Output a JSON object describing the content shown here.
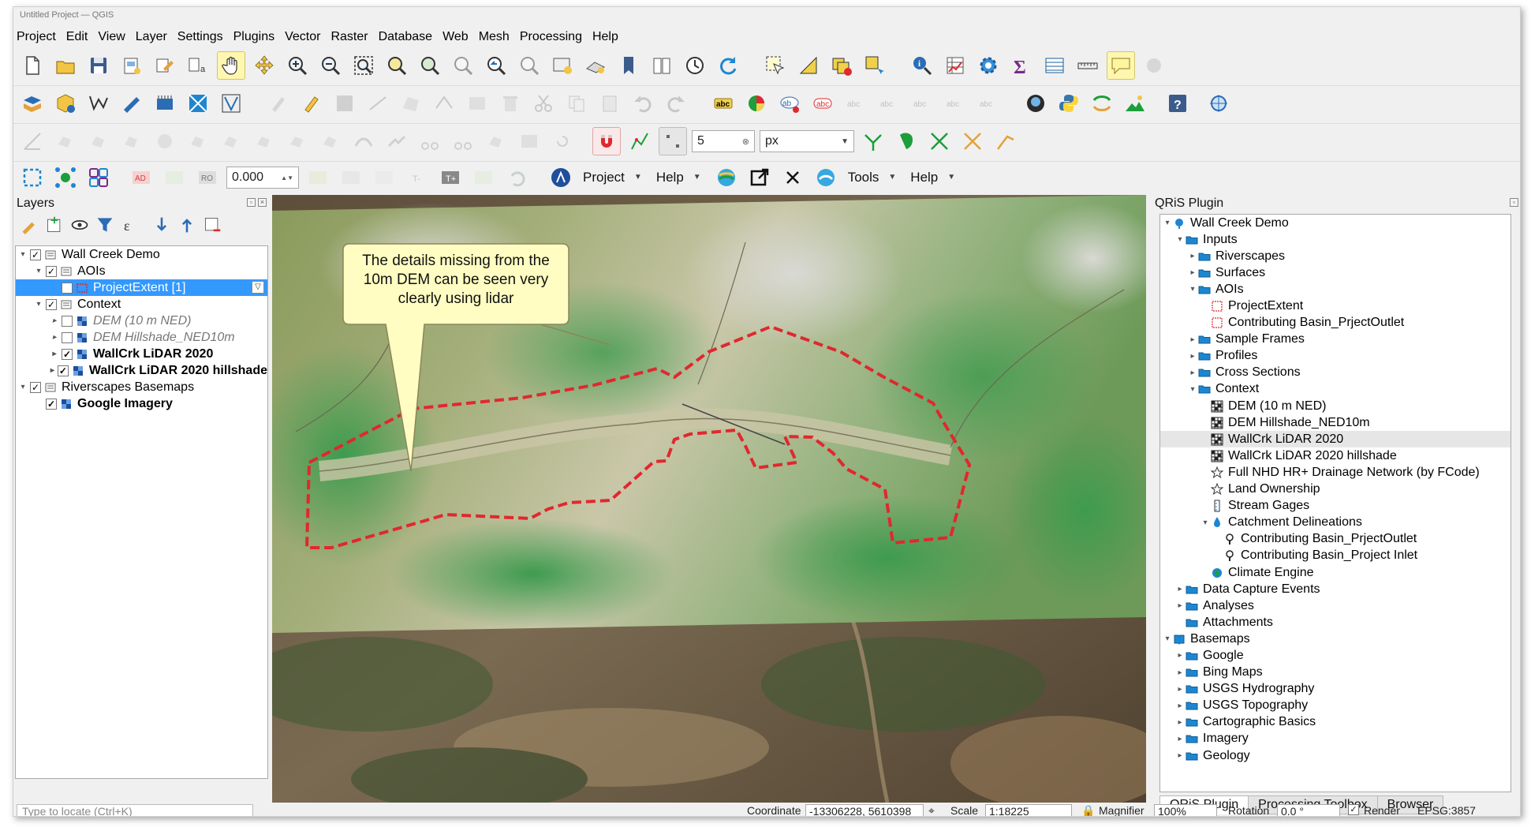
{
  "window": {
    "title": "Untitled Project — QGIS"
  },
  "menu": [
    "Project",
    "Edit",
    "View",
    "Layer",
    "Settings",
    "Plugins",
    "Vector",
    "Raster",
    "Database",
    "Web",
    "Mesh",
    "Processing",
    "Help"
  ],
  "snapping": {
    "tolerance": "5",
    "unit": "px"
  },
  "digitize": {
    "value": "0.000"
  },
  "plugin_toolbar": {
    "project": "Project",
    "help": "Help",
    "tools": "Tools",
    "help2": "Help"
  },
  "label_badges": {
    "abc": "abc",
    "ad": "AD",
    "ro": "RO",
    "t": "T+"
  },
  "layers": {
    "title": "Layers",
    "items": [
      {
        "label": "Wall Creek Demo",
        "indent": 0,
        "checked": true,
        "arrow": "▾",
        "style": "",
        "icon": "group"
      },
      {
        "label": "AOIs",
        "indent": 1,
        "checked": true,
        "arrow": "▾",
        "style": "",
        "icon": "group"
      },
      {
        "label": "ProjectExtent [1]",
        "indent": 2,
        "checked": true,
        "arrow": "",
        "style": "sel",
        "icon": "poly"
      },
      {
        "label": "Context",
        "indent": 1,
        "checked": true,
        "arrow": "▾",
        "style": "",
        "icon": "group"
      },
      {
        "label": "DEM (10 m NED)",
        "indent": 2,
        "checked": false,
        "arrow": "▸",
        "style": "ital",
        "icon": "raster"
      },
      {
        "label": "DEM Hillshade_NED10m",
        "indent": 2,
        "checked": false,
        "arrow": "▸",
        "style": "ital",
        "icon": "raster"
      },
      {
        "label": "WallCrk LiDAR 2020",
        "indent": 2,
        "checked": true,
        "arrow": "▸",
        "style": "bold",
        "icon": "raster"
      },
      {
        "label": "WallCrk LiDAR 2020 hillshade",
        "indent": 2,
        "checked": true,
        "arrow": "▸",
        "style": "bold",
        "icon": "raster"
      },
      {
        "label": "Riverscapes Basemaps",
        "indent": 0,
        "checked": true,
        "arrow": "▾",
        "style": "",
        "icon": "group"
      },
      {
        "label": "Google Imagery",
        "indent": 1,
        "checked": true,
        "arrow": "",
        "style": "bold",
        "icon": "raster"
      }
    ]
  },
  "locator": {
    "placeholder": "Type to locate (Ctrl+K)"
  },
  "callout": {
    "text": "The details missing from the 10m DEM can be seen very clearly using lidar"
  },
  "qris": {
    "title": "QRiS Plugin",
    "tree": [
      {
        "label": "Wall Creek Demo",
        "indent": 0,
        "arrow": "▾",
        "icon": "project"
      },
      {
        "label": "Inputs",
        "indent": 1,
        "arrow": "▾",
        "icon": "folder"
      },
      {
        "label": "Riverscapes",
        "indent": 2,
        "arrow": "▸",
        "icon": "folder"
      },
      {
        "label": "Surfaces",
        "indent": 2,
        "arrow": "▸",
        "icon": "folder"
      },
      {
        "label": "AOIs",
        "indent": 2,
        "arrow": "▾",
        "icon": "folder"
      },
      {
        "label": "ProjectExtent",
        "indent": 3,
        "arrow": "",
        "icon": "aoi"
      },
      {
        "label": "Contributing Basin_PrjectOutlet",
        "indent": 3,
        "arrow": "",
        "icon": "aoi"
      },
      {
        "label": "Sample Frames",
        "indent": 2,
        "arrow": "▸",
        "icon": "folder"
      },
      {
        "label": "Profiles",
        "indent": 2,
        "arrow": "▸",
        "icon": "folder"
      },
      {
        "label": "Cross Sections",
        "indent": 2,
        "arrow": "▸",
        "icon": "folder"
      },
      {
        "label": "Context",
        "indent": 2,
        "arrow": "▾",
        "icon": "folder"
      },
      {
        "label": "DEM (10 m NED)",
        "indent": 3,
        "arrow": "",
        "icon": "raster"
      },
      {
        "label": "DEM Hillshade_NED10m",
        "indent": 3,
        "arrow": "",
        "icon": "raster"
      },
      {
        "label": "WallCrk LiDAR 2020",
        "indent": 3,
        "arrow": "",
        "icon": "raster",
        "hl": true
      },
      {
        "label": "WallCrk LiDAR 2020 hillshade",
        "indent": 3,
        "arrow": "",
        "icon": "raster"
      },
      {
        "label": "Full NHD HR+ Drainage Network (by FCode)",
        "indent": 3,
        "arrow": "",
        "icon": "star"
      },
      {
        "label": "Land Ownership",
        "indent": 3,
        "arrow": "",
        "icon": "star"
      },
      {
        "label": "Stream Gages",
        "indent": 3,
        "arrow": "",
        "icon": "gage"
      },
      {
        "label": "Catchment Delineations",
        "indent": 3,
        "arrow": "▾",
        "icon": "drop"
      },
      {
        "label": "Contributing Basin_PrjectOutlet",
        "indent": 4,
        "arrow": "",
        "icon": "pin"
      },
      {
        "label": "Contributing Basin_Project Inlet",
        "indent": 4,
        "arrow": "",
        "icon": "pin"
      },
      {
        "label": "Climate Engine",
        "indent": 3,
        "arrow": "",
        "icon": "climate"
      },
      {
        "label": "Data Capture Events",
        "indent": 1,
        "arrow": "▸",
        "icon": "folder"
      },
      {
        "label": "Analyses",
        "indent": 1,
        "arrow": "▸",
        "icon": "folder"
      },
      {
        "label": "Attachments",
        "indent": 1,
        "arrow": "",
        "icon": "folder"
      },
      {
        "label": "Basemaps",
        "indent": 0,
        "arrow": "▾",
        "icon": "book"
      },
      {
        "label": "Google",
        "indent": 1,
        "arrow": "▸",
        "icon": "folder"
      },
      {
        "label": "Bing Maps",
        "indent": 1,
        "arrow": "▸",
        "icon": "folder"
      },
      {
        "label": "USGS Hydrography",
        "indent": 1,
        "arrow": "▸",
        "icon": "folder"
      },
      {
        "label": "USGS Topography",
        "indent": 1,
        "arrow": "▸",
        "icon": "folder"
      },
      {
        "label": "Cartographic Basics",
        "indent": 1,
        "arrow": "▸",
        "icon": "folder"
      },
      {
        "label": "Imagery",
        "indent": 1,
        "arrow": "▸",
        "icon": "folder"
      },
      {
        "label": "Geology",
        "indent": 1,
        "arrow": "▸",
        "icon": "folder"
      }
    ],
    "tabs": [
      "QRiS Plugin",
      "Processing Toolbox",
      "Browser"
    ]
  },
  "status": {
    "coordinate_label": "Coordinate",
    "coordinate": "-13306228, 5610398",
    "scale_label": "Scale",
    "scale": "1:18225",
    "magnifier_label": "Magnifier",
    "magnifier": "100%",
    "rotation_label": "Rotation",
    "rotation": "0.0 °",
    "render_label": "Render",
    "crs": "EPSG:3857"
  },
  "colors": {
    "aoi": "#e0282e",
    "callout": "#fffdc2",
    "folder": "#1e86d0",
    "selection": "#3399ff"
  }
}
